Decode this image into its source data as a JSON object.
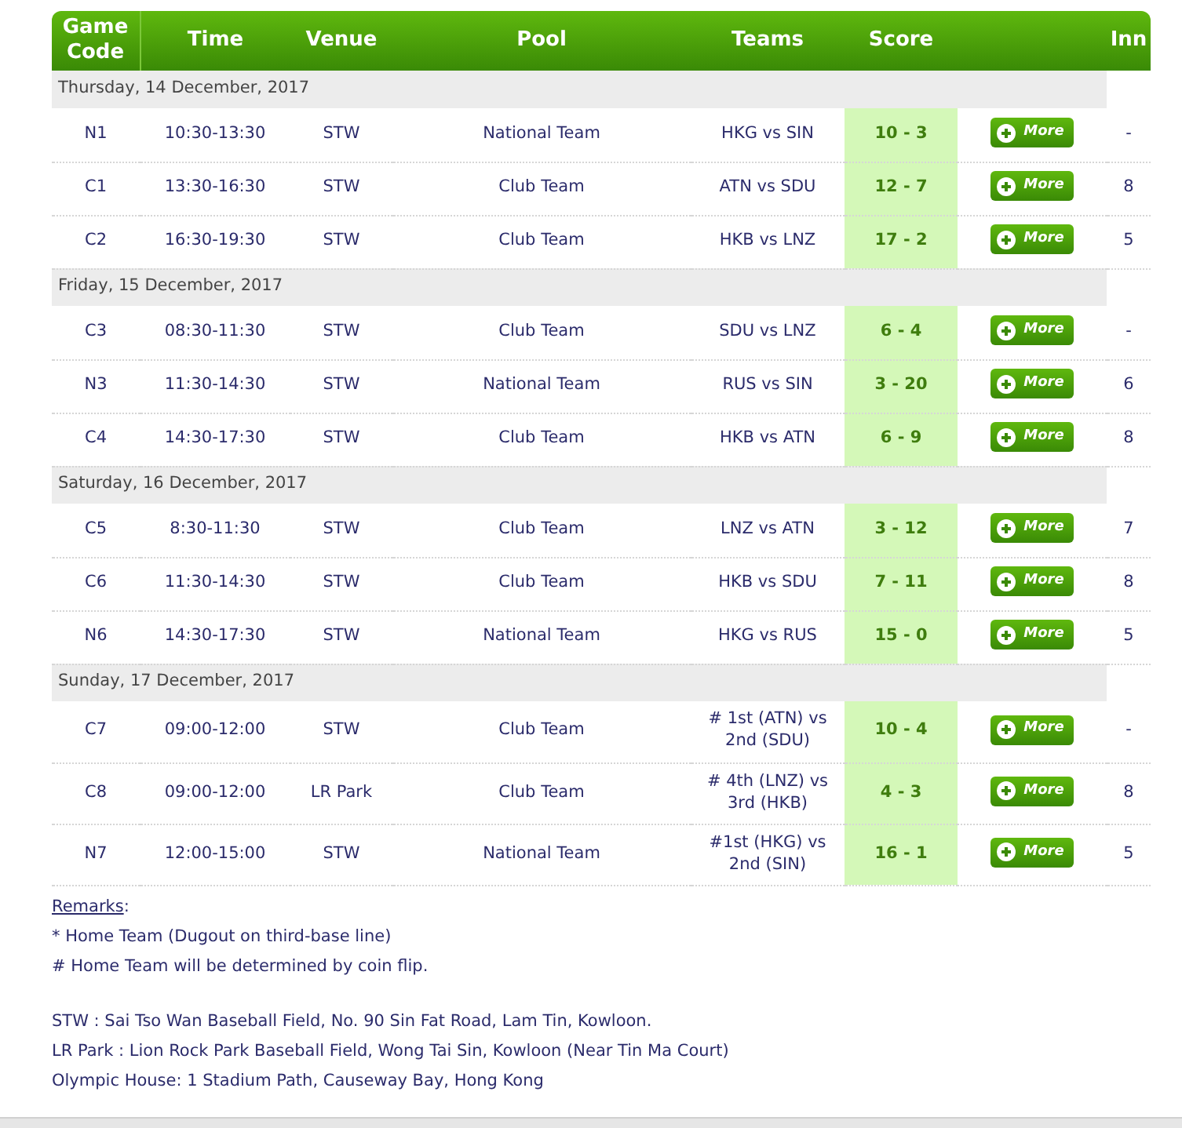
{
  "columns": [
    "Game Code",
    "Time",
    "Venue",
    "Pool",
    "Teams",
    "Score",
    "",
    "Inn"
  ],
  "days": [
    {
      "date": "Thursday, 14 December, 2017",
      "games": [
        {
          "code": "N1",
          "time": "10:30-13:30",
          "venue": "STW",
          "pool": "National Team",
          "teams": "HKG vs SIN",
          "score": "10 - 3",
          "button": "More",
          "inn": "-"
        },
        {
          "code": "C1",
          "time": "13:30-16:30",
          "venue": "STW",
          "pool": "Club Team",
          "teams": "ATN vs SDU",
          "score": "12 - 7",
          "button": "More",
          "inn": "8"
        },
        {
          "code": "C2",
          "time": "16:30-19:30",
          "venue": "STW",
          "pool": "Club Team",
          "teams": "HKB vs LNZ",
          "score": "17 - 2",
          "button": "More",
          "inn": "5"
        }
      ]
    },
    {
      "date": "Friday, 15 December, 2017",
      "games": [
        {
          "code": "C3",
          "time": "08:30-11:30",
          "venue": "STW",
          "pool": "Club Team",
          "teams": "SDU vs LNZ",
          "score": "6 - 4",
          "button": "More",
          "inn": "-"
        },
        {
          "code": "N3",
          "time": "11:30-14:30",
          "venue": "STW",
          "pool": "National Team",
          "teams": "RUS vs SIN",
          "score": "3 - 20",
          "button": "More",
          "inn": "6"
        },
        {
          "code": "C4",
          "time": "14:30-17:30",
          "venue": "STW",
          "pool": "Club Team",
          "teams": "HKB vs ATN",
          "score": "6 - 9",
          "button": "More",
          "inn": "8"
        }
      ]
    },
    {
      "date": "Saturday, 16 December, 2017",
      "games": [
        {
          "code": "C5",
          "time": "8:30-11:30",
          "venue": "STW",
          "pool": "Club Team",
          "teams": "LNZ vs ATN",
          "score": "3 - 12",
          "button": "More",
          "inn": "7"
        },
        {
          "code": "C6",
          "time": "11:30-14:30",
          "venue": "STW",
          "pool": "Club Team",
          "teams": "HKB vs SDU",
          "score": "7 - 11",
          "button": "More",
          "inn": "8"
        },
        {
          "code": "N6",
          "time": "14:30-17:30",
          "venue": "STW",
          "pool": "National Team",
          "teams": "HKG vs RUS",
          "score": "15 - 0",
          "button": "More",
          "inn": "5"
        }
      ]
    },
    {
      "date": "Sunday, 17 December, 2017",
      "games": [
        {
          "code": "C7",
          "time": "09:00-12:00",
          "venue": "STW",
          "pool": "Club Team",
          "teams": "# 1st (ATN) vs 2nd (SDU)",
          "score": "10 - 4",
          "button": "More",
          "inn": "-"
        },
        {
          "code": "C8",
          "time": "09:00-12:00",
          "venue": "LR Park",
          "pool": "Club Team",
          "teams": "# 4th (LNZ) vs 3rd (HKB)",
          "score": "4 - 3",
          "button": "More",
          "inn": "8"
        },
        {
          "code": "N7",
          "time": "12:00-15:00",
          "venue": "STW",
          "pool": "National Team",
          "teams": "#1st (HKG) vs 2nd (SIN)",
          "score": "16 - 1",
          "button": "More",
          "inn": "5"
        }
      ]
    }
  ],
  "remarks": {
    "title": "Remarks",
    "suffix": ":",
    "lines": [
      "* Home Team (Dugout on third-base line)",
      "# Home Team will be determined by coin flip."
    ]
  },
  "venues": [
    "STW : Sai Tso Wan Baseball Field, No. 90 Sin Fat Road, Lam Tin, Kowloon.",
    "LR Park : Lion Rock Park Baseball Field, Wong Tai Sin, Kowloon (Near Tin Ma Court)",
    "Olympic House: 1 Stadium Path, Causeway Bay, Hong Kong"
  ]
}
